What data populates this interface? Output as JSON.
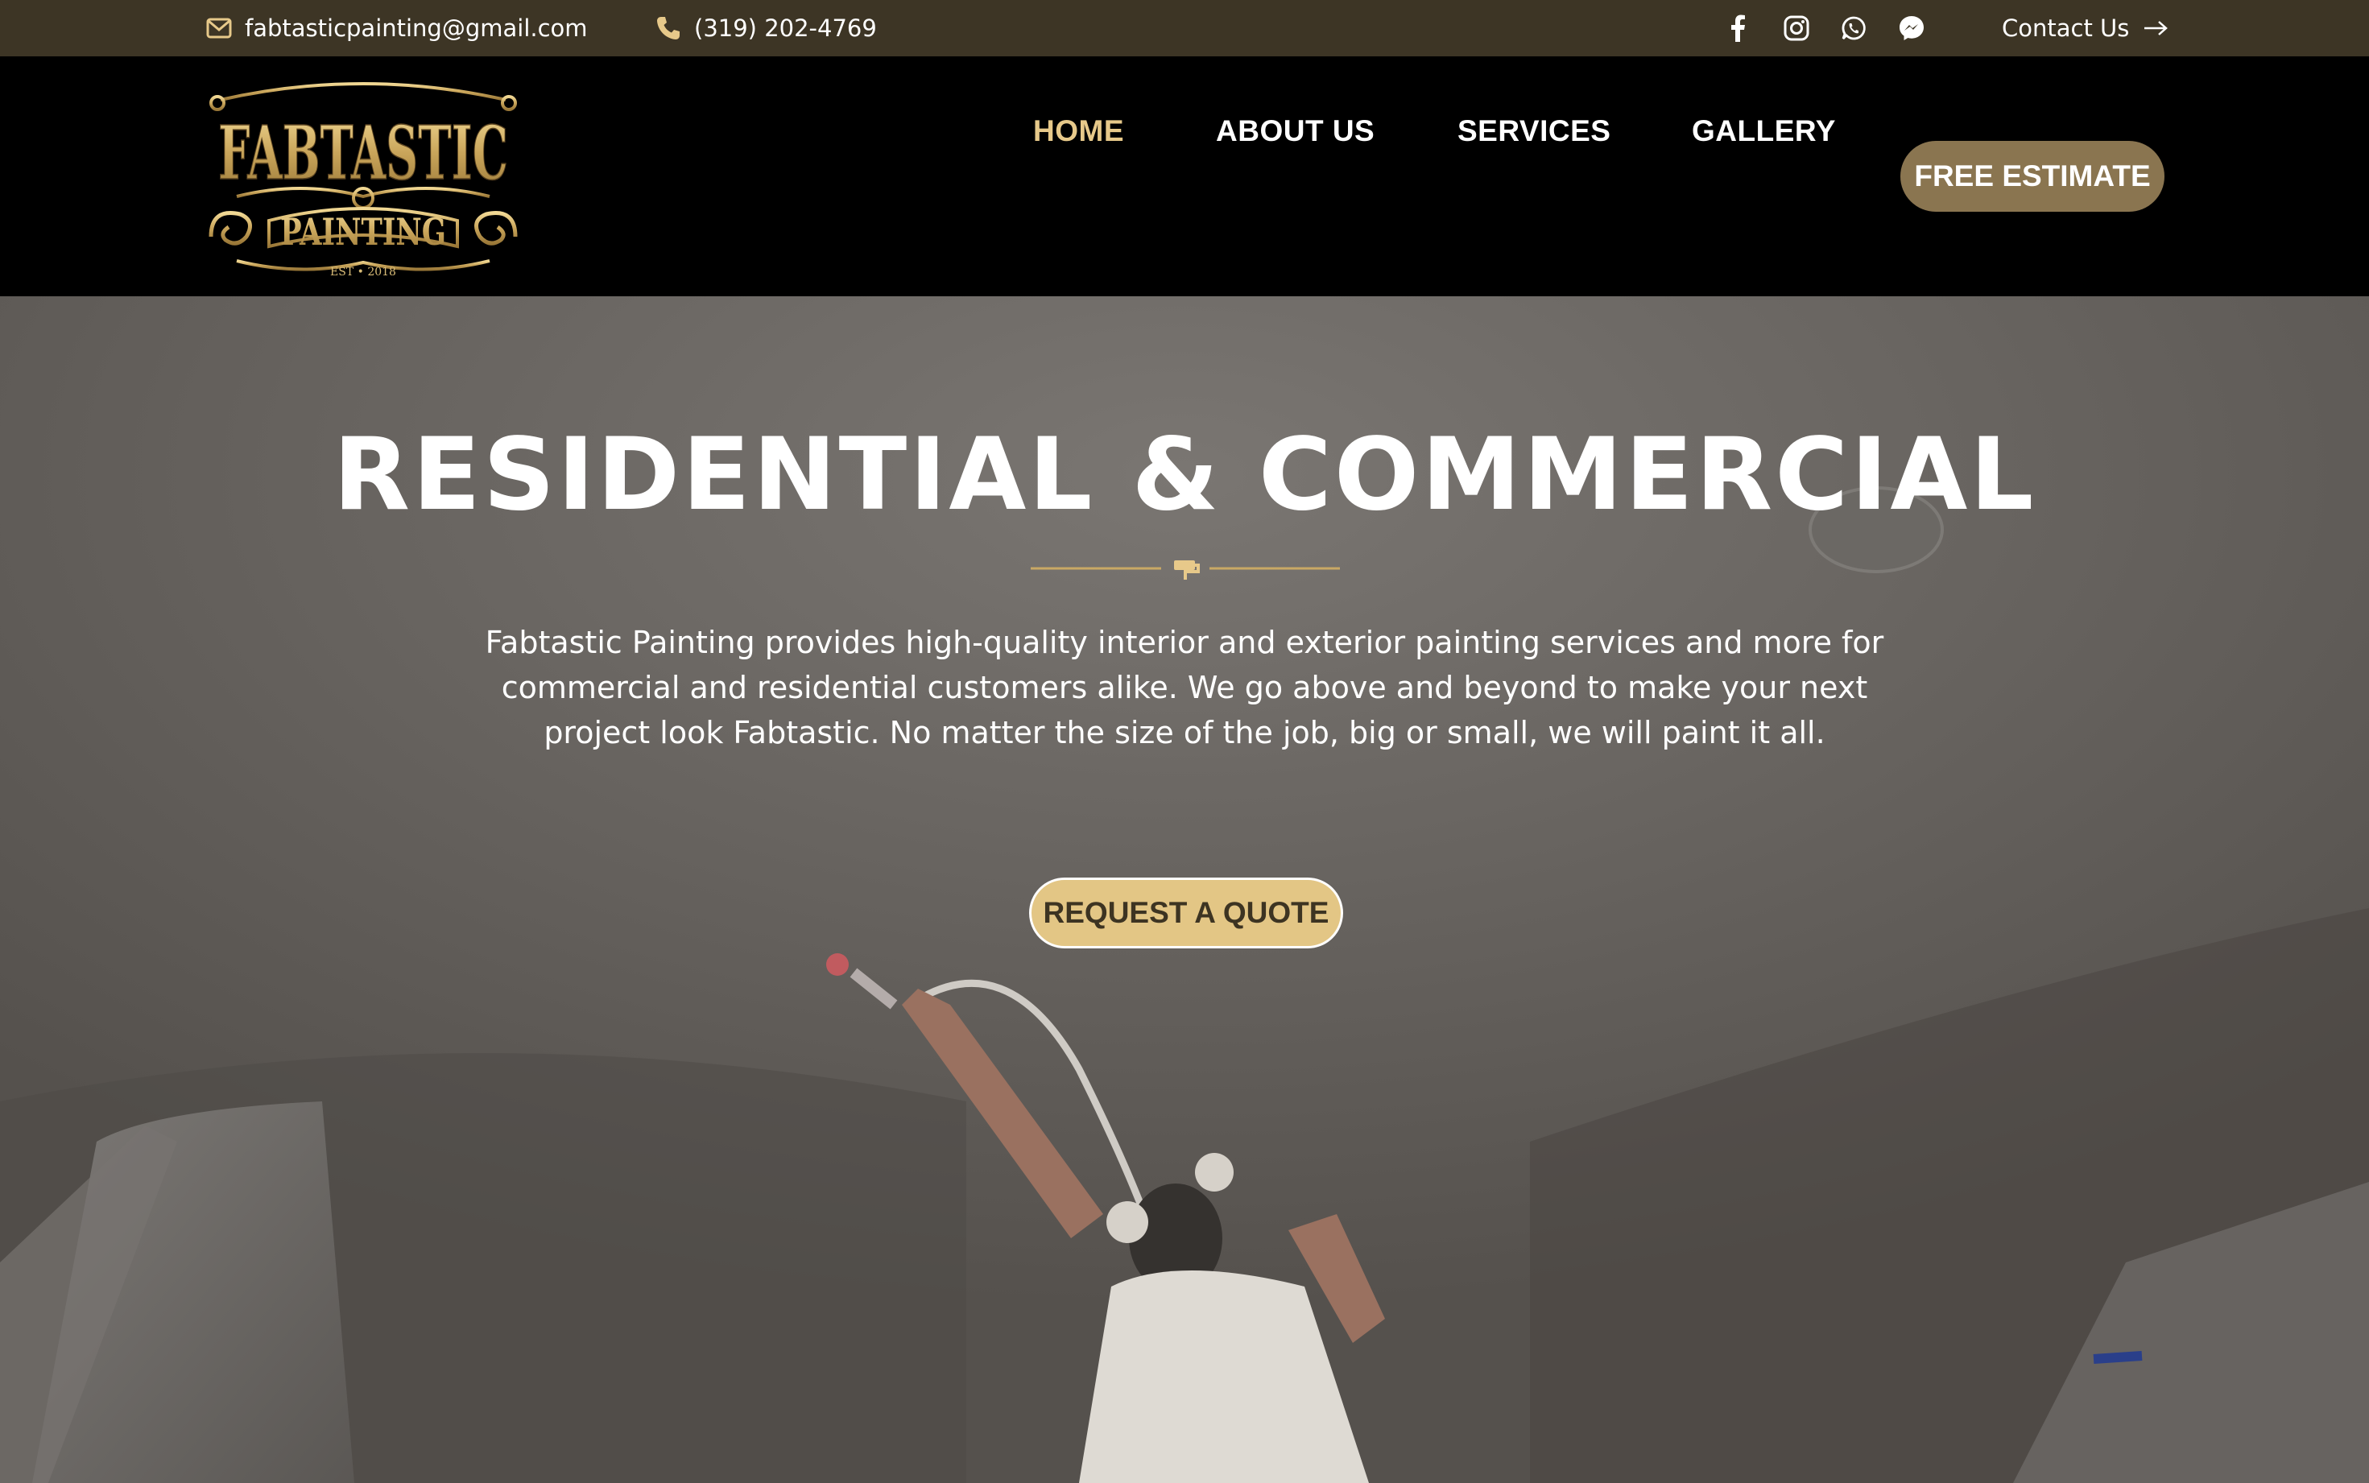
{
  "topbar": {
    "email": "fabtasticpainting@gmail.com",
    "phone": "(319) 202-4769",
    "contact_label": "Contact Us"
  },
  "logo": {
    "line1": "FABTASTIC",
    "line2": "PAINTING",
    "est": "EST • 2018"
  },
  "nav": {
    "home": "HOME",
    "about": "ABOUT US",
    "services": "SERVICES",
    "gallery": "GALLERY",
    "estimate": "FREE ESTIMATE"
  },
  "hero": {
    "title": "RESIDENTIAL & COMMERCIAL",
    "description": "Fabtastic Painting provides high-quality interior and exterior painting services and more for commercial and residential customers alike. We go above and beyond to make your next project look Fabtastic. No matter the size of the job, big or small, we will paint it all.",
    "cta": "REQUEST A QUOTE"
  },
  "colors": {
    "topbar_bg": "#3d3525",
    "header_bg": "#000000",
    "accent_gold": "#e7c98a",
    "estimate_btn": "#8a7550",
    "quote_btn": "#e3c685",
    "quote_text": "#3d3422"
  },
  "icons": [
    "mail-icon",
    "phone-icon",
    "facebook-icon",
    "instagram-icon",
    "whatsapp-icon",
    "messenger-icon",
    "arrow-right-icon",
    "paint-roller-icon"
  ]
}
